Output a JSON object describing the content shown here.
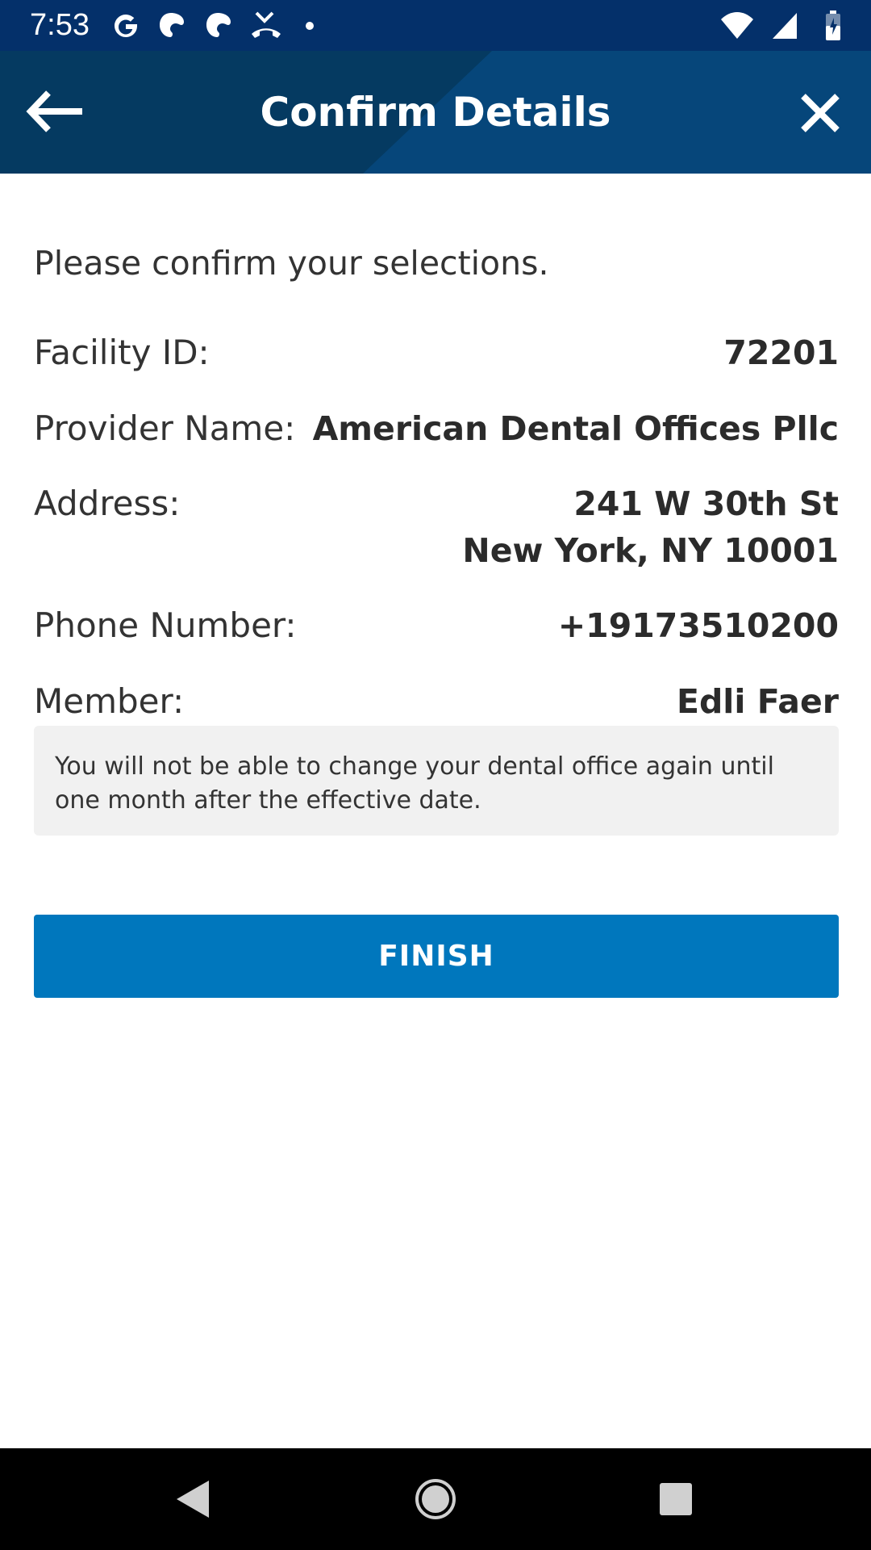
{
  "status_bar": {
    "time": "7:53",
    "left_icons": [
      "google-icon",
      "notification-icon",
      "notification-icon",
      "missed-call-icon",
      "dot-icon"
    ],
    "right_icons": [
      "wifi-icon",
      "signal-icon",
      "battery-icon"
    ]
  },
  "app_bar": {
    "title": "Confirm Details",
    "back_icon": "arrow-left-icon",
    "close_icon": "close-icon",
    "background_color": "#053a61"
  },
  "content": {
    "intro": "Please confirm your selections.",
    "rows": [
      {
        "label": "Facility ID:",
        "value": "72201"
      },
      {
        "label": "Provider Name:",
        "value": "American Dental Offices Pllc"
      },
      {
        "label": "Address:",
        "value_line1": "241 W 30th St",
        "value_line2": "New York, NY 10001"
      },
      {
        "label": "Phone Number:",
        "value": "+19173510200"
      },
      {
        "label": "Member:",
        "value": "Edli Faer"
      }
    ],
    "notice": "You will not be able to change your dental office again until one month after the effective date.",
    "finish_label": "FINISH",
    "accent_color": "#0077bd"
  },
  "nav_bar": {
    "icons": [
      "back-triangle-icon",
      "home-circle-icon",
      "recents-square-icon"
    ]
  }
}
